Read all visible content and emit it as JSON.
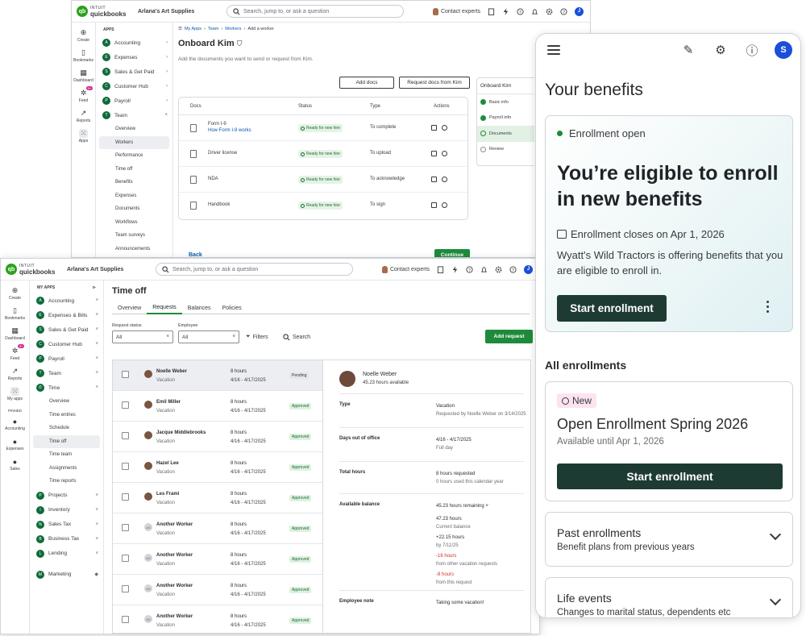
{
  "brand": {
    "intuit": "INTUIT",
    "name": "quickbooks",
    "company": "Arlana's Art Supplies",
    "green": "#2ca01c",
    "dark_green": "#1d3b33"
  },
  "topbar": {
    "search_placeholder": "Search, jump to, or ask a question",
    "contact": "Contact experts",
    "avatar": "J"
  },
  "rail1": [
    "Create",
    "Bookmarks",
    "Dashboard",
    "Feed",
    "Reports",
    "Apps"
  ],
  "rail2": [
    "Create",
    "Bookmarks",
    "Dashboard",
    "Feed",
    "Reports",
    "My apps"
  ],
  "rail2_pinned": {
    "label": "PINNED",
    "items": [
      "Accounting",
      "Expenses",
      "Sales"
    ]
  },
  "feed_badge": "9+",
  "nav1": {
    "head": "APPS",
    "apps": [
      "Accounting",
      "Expenses",
      "Sales & Get Paid",
      "Customer Hub",
      "Payroll",
      "Team"
    ],
    "team_subs": [
      "Overview",
      "Workers",
      "Performance",
      "Time off",
      "Benefits",
      "Expenses",
      "Documents",
      "Workflows",
      "Team surveys",
      "Announcements"
    ]
  },
  "nav2": {
    "head": "MY APPS",
    "apps_top": [
      "Accounting",
      "Expenses & Bills",
      "Sales & Get Paid",
      "Customer Hub",
      "Payroll",
      "Team",
      "Time"
    ],
    "time_subs": [
      "Overview",
      "Time entries",
      "Schedule",
      "Time off",
      "Time team",
      "Assignments",
      "Time reports"
    ],
    "apps_bottom": [
      "Projects",
      "Inventory",
      "Sales Tax",
      "Business Tax",
      "Lending"
    ],
    "marketing": "Marketing"
  },
  "onboard": {
    "crumbs": [
      "My Apps",
      "Team",
      "Workers",
      "Add a worker"
    ],
    "title": "Onboard Kim",
    "desc": "Add the documents you want to send or request from Kim.",
    "add_docs": "Add docs",
    "request_docs": "Request docs from Kim",
    "headers": {
      "docs": "Docs",
      "status": "Status",
      "type": "Type",
      "actions": "Actions"
    },
    "rows": [
      {
        "name": "Form I-9",
        "link": "How Form I-9 works",
        "status": "Ready for new hire",
        "type": "To complete"
      },
      {
        "name": "Driver license",
        "status": "Ready for new hire",
        "type": "To upload"
      },
      {
        "name": "NDA",
        "status": "Ready for new hire",
        "type": "To acknowledge"
      },
      {
        "name": "Handbook",
        "status": "Ready for new hire",
        "type": "To sign"
      }
    ],
    "steps_title": "Onboard Kim",
    "steps": [
      "Basic info",
      "Payroll info",
      "Documents",
      "Review"
    ],
    "back": "Back",
    "continue": "Continue"
  },
  "timeoff": {
    "title": "Time off",
    "tabs": [
      "Overview",
      "Requests",
      "Balances",
      "Policies"
    ],
    "status_label": "Request status",
    "status_value": "All",
    "employee_label": "Employee",
    "employee_value": "All",
    "filters": "Filters",
    "search": "Search",
    "add_request": "Add request",
    "rows": [
      {
        "name": "Noelle Weber",
        "type": "Vacation",
        "hours": "8 hours",
        "dates": "4/16 - 4/17/2025",
        "status": "Pending"
      },
      {
        "name": "Emil Miller",
        "type": "Vacation",
        "hours": "8 hours",
        "dates": "4/16 - 4/17/2025",
        "status": "Approved"
      },
      {
        "name": "Jacque Middlebrooks",
        "type": "Vacation",
        "hours": "8 hours",
        "dates": "4/16 - 4/17/2025",
        "status": "Approved"
      },
      {
        "name": "Hazel Lee",
        "type": "Vacation",
        "hours": "8 hours",
        "dates": "4/16 - 4/17/2025",
        "status": "Approved"
      },
      {
        "name": "Les Frami",
        "type": "Vacation",
        "hours": "8 hours",
        "dates": "4/16 - 4/17/2025",
        "status": "Approved"
      },
      {
        "name": "Another Worker",
        "type": "Vacation",
        "hours": "8 hours",
        "dates": "4/16 - 4/17/2025",
        "status": "Approved",
        "initials": "AS"
      },
      {
        "name": "Another Worker",
        "type": "Vacation",
        "hours": "8 hours",
        "dates": "4/16 - 4/17/2025",
        "status": "Approved",
        "initials": "AS"
      },
      {
        "name": "Another Worker",
        "type": "Vacation",
        "hours": "8 hours",
        "dates": "4/16 - 4/17/2025",
        "status": "Approved",
        "initials": "AS"
      },
      {
        "name": "Another Worker",
        "type": "Vacation",
        "hours": "8 hours",
        "dates": "4/16 - 4/17/2025",
        "status": "Approved",
        "initials": "AS"
      }
    ],
    "detail": {
      "name": "Noelle Weber",
      "available": "45.23 hours available",
      "type_label": "Type",
      "type_value": "Vacation",
      "type_note": "Requested by Noelle Weber on 3/14/2025",
      "days_label": "Days out of office",
      "days_value": "4/16 - 4/17/2025",
      "days_note": "Full day",
      "total_label": "Total hours",
      "total_value": "8 hours requested",
      "total_note": "0 hours used this calendar year",
      "bal_label": "Available balance",
      "bal_value": "45.23 hours remaining",
      "bal_lines": [
        {
          "v": "47.23 hours",
          "n": "Current balance",
          "red": false
        },
        {
          "v": "+22.15 hours",
          "n": "by 7/11/25",
          "red": false
        },
        {
          "v": "-16 hours",
          "n": "from other vacation requests",
          "red": true
        },
        {
          "v": "-8 hours",
          "n": "from this request",
          "red": true
        }
      ],
      "note_label": "Employee note",
      "note_value": "Taking some vacation!"
    }
  },
  "mobile": {
    "avatar": "S",
    "title": "Your benefits",
    "hero_status": "Enrollment open",
    "hero_heading": "You’re eligible to enroll in new benefits",
    "hero_close": "Enrollment closes on Apr 1, 2026",
    "hero_desc": "Wyatt's Wild Tractors is offering benefits that you are eligible to enroll in.",
    "hero_btn": "Start enrollment",
    "all_enrollments": "All enrollments",
    "new_badge": "New",
    "enr_title": "Open Enrollment Spring 2026",
    "enr_sub": "Available until Apr 1, 2026",
    "enr_btn": "Start enrollment",
    "past_title": "Past enrollments",
    "past_sub": "Benefit plans from previous years",
    "life_title": "Life events",
    "life_sub": "Changes to marital status, dependents etc"
  }
}
